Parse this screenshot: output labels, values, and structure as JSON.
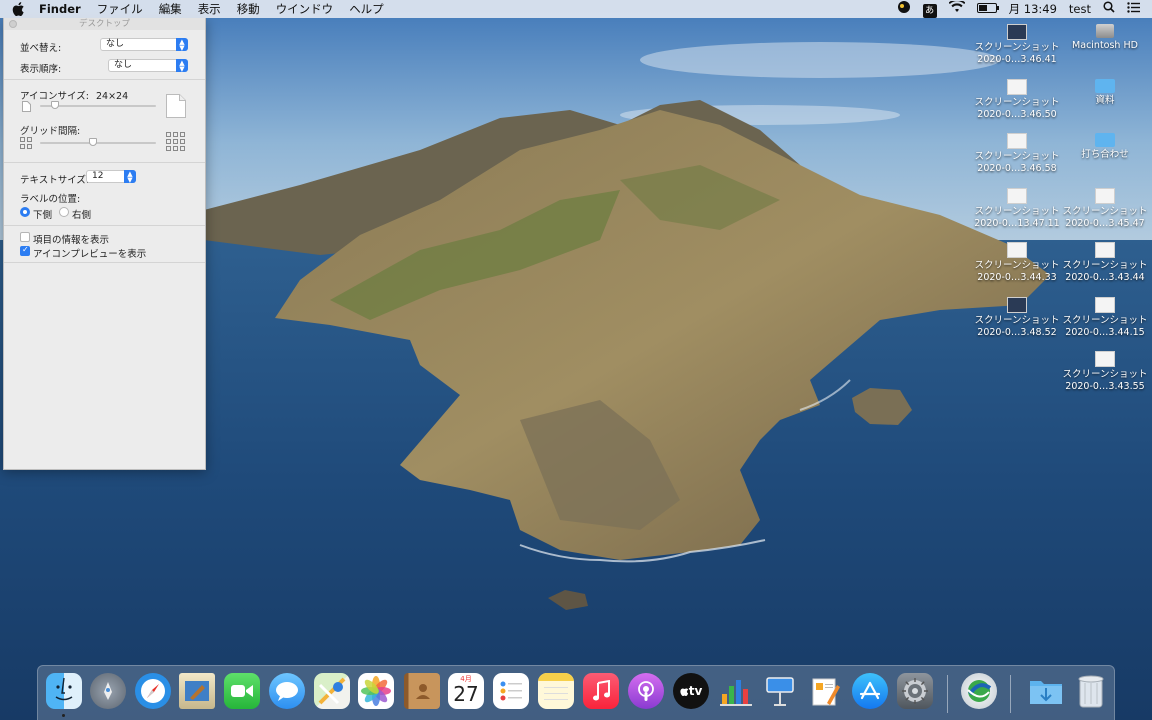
{
  "menubar": {
    "app": "Finder",
    "items": [
      "ファイル",
      "編集",
      "表示",
      "移動",
      "ウインドウ",
      "ヘルプ"
    ],
    "input_method": "あ",
    "battery": "62",
    "clock": "月 13:49",
    "user": "test"
  },
  "panel": {
    "title": "デスクトップ",
    "sort_label": "並べ替え:",
    "sort_value": "なし",
    "order_label": "表示順序:",
    "order_value": "なし",
    "icon_size_label": "アイコンサイズ:",
    "icon_size_value": "24×24",
    "grid_label": "グリッド間隔:",
    "text_size_label": "テキストサイズ:",
    "text_size_value": "12",
    "label_pos_label": "ラベルの位置:",
    "label_bottom": "下側",
    "label_right": "右側",
    "show_info_label": "項目の情報を表示",
    "show_preview_label": "アイコンプレビューを表示",
    "show_info_checked": false,
    "show_preview_checked": true,
    "icon_size_slider": 0.1,
    "grid_slider": 0.45
  },
  "desktop": {
    "icons": [
      {
        "line1": "スクリーンショット",
        "line2": "2020-0…3.46.41",
        "kind": "shot-dark"
      },
      {
        "line1": "Macintosh HD",
        "line2": "",
        "kind": "hd"
      },
      {
        "line1": "スクリーンショット",
        "line2": "2020-0…3.46.50",
        "kind": "shot"
      },
      {
        "line1": "資料",
        "line2": "",
        "kind": "folder"
      },
      {
        "line1": "スクリーンショット",
        "line2": "2020-0…3.46.58",
        "kind": "shot"
      },
      {
        "line1": "打ち合わせ",
        "line2": "",
        "kind": "folder"
      },
      {
        "line1": "スクリーンショット",
        "line2": "2020-0…13.47.11",
        "kind": "shot"
      },
      {
        "line1": "スクリーンショット",
        "line2": "2020-0…3.45.47",
        "kind": "shot"
      },
      {
        "line1": "スクリーンショット",
        "line2": "2020-0…3.44.33",
        "kind": "shot"
      },
      {
        "line1": "スクリーンショット",
        "line2": "2020-0…3.43.44",
        "kind": "shot"
      },
      {
        "line1": "スクリーンショット",
        "line2": "2020-0…3.48.52",
        "kind": "shot-dark"
      },
      {
        "line1": "スクリーンショット",
        "line2": "2020-0…3.44.15",
        "kind": "shot"
      },
      {
        "line1": "スクリーンショット",
        "line2": "2020-0…3.43.55",
        "kind": "shot"
      }
    ]
  },
  "dock": {
    "calendar_month": "4月",
    "calendar_day": "27",
    "tv_label": "tv",
    "apps": [
      "finder-icon",
      "launchpad-icon",
      "safari-icon",
      "mail-icon",
      "facetime-icon",
      "messages-icon",
      "maps-icon",
      "photos-icon",
      "contacts-icon",
      "calendar-icon",
      "reminders-icon",
      "notes-icon",
      "music-icon",
      "podcasts-icon",
      "tv-icon",
      "numbers-icon",
      "keynote-icon",
      "pages-icon",
      "app-store-icon",
      "system-preferences-icon",
      "network-app-icon",
      "downloads-folder-icon",
      "trash-icon"
    ]
  }
}
